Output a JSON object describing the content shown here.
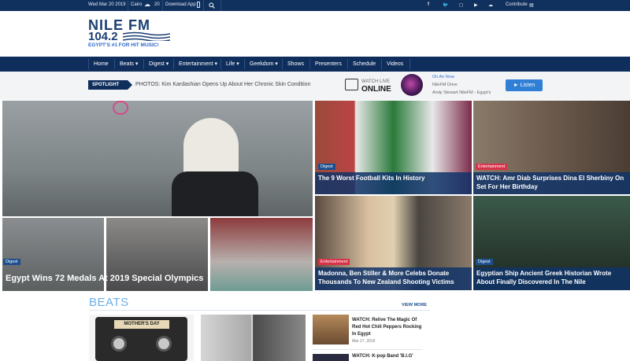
{
  "topbar": {
    "date": "Wed Mar 20 2019",
    "city": "Cairo",
    "temperature": "20",
    "download": "Download App",
    "contribute": "Contribute"
  },
  "logo": {
    "brand": "NILE FM",
    "frequency": "104.2",
    "tagline": "EGYPT'S #1 FOR HIT MUSIC!"
  },
  "nav": [
    {
      "label": "Home"
    },
    {
      "label": "Beats ▾"
    },
    {
      "label": "Digest ▾"
    },
    {
      "label": "Entertainment ▾"
    },
    {
      "label": "Life ▾"
    },
    {
      "label": "Geekdom ▾"
    },
    {
      "label": "Shows"
    },
    {
      "label": "Presenters"
    },
    {
      "label": "Schedule"
    },
    {
      "label": "Videos"
    }
  ],
  "spotlight": {
    "label": "SPOTLIGHT",
    "headline": "PHOTOS: Kim Kardashian Opens Up About Her Chronic Skin Condition"
  },
  "live": {
    "watch": "WATCH LIVE",
    "online": "ONLINE",
    "on_air": "On Air Now",
    "show": "NileFM Drive",
    "host": "Andy Stewart NileFM - Egypt's",
    "listen": "► Listen"
  },
  "hero": {
    "badge": "Digest",
    "title": "Egypt Wins 72 Medals At 2019 Special Olympics"
  },
  "tiles": [
    {
      "badge": "Digest",
      "title": "The 9 Worst Football Kits In History"
    },
    {
      "badge": "Entertainment",
      "title": "WATCH: Amr Diab Surprises Dina El Sherbiny On Set For Her Birthday"
    },
    {
      "badge": "Entertainment",
      "title": "Madonna, Ben Stiller & More Celebs Donate Thousands To New Zealand Shooting Victims"
    },
    {
      "badge": "Digest",
      "title": "Egyptian Ship Ancient Greek Historian Wrote About Finally Discovered In The Nile"
    }
  ],
  "beats": {
    "title": "BEATS",
    "view_more": "VIEW MORE",
    "tape_label": "MOTHER'S DAY",
    "item1_title": "WATCH: Relive The Magic Of Red Hot Chili Peppers Rocking In Egypt",
    "item1_date": "Mar 17, 2019",
    "item2_title": "WATCH: K-pop Band 'B.I.G'"
  },
  "colors": {
    "navy": "#0f2e5c",
    "accent_blue": "#2f7fd6",
    "badge_red": "#d8324a",
    "badge_blue": "#1c4f8e"
  }
}
